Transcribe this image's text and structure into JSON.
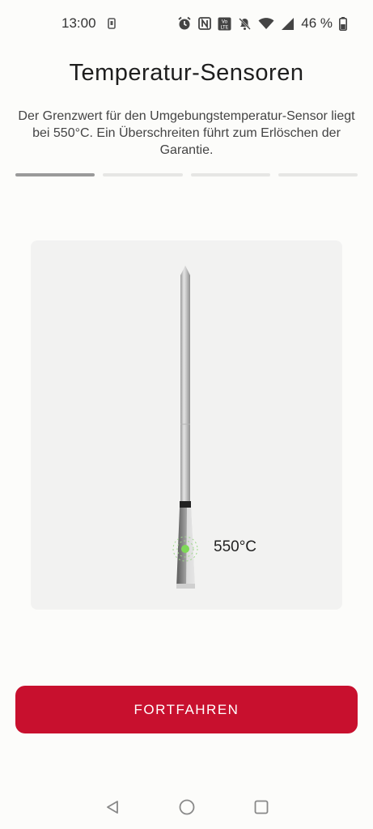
{
  "status_bar": {
    "time": "13:00",
    "battery_percent": "46 %",
    "icons": [
      "phone-notification-icon",
      "alarm-icon",
      "nfc-icon",
      "volte-icon",
      "mute-icon",
      "wifi-icon",
      "signal-icon",
      "battery-icon"
    ]
  },
  "page": {
    "title": "Temperatur-Sensoren",
    "description": "Der Grenzwert für den Umgebungstemperatur-Sensor liegt bei 550°C. Ein Überschreiten führt zum Erlöschen der Garantie."
  },
  "progress": {
    "total_steps": 4,
    "current_step": 1
  },
  "illustration": {
    "sensor_label": "550°C",
    "sensor_indicator_color": "#7ed957"
  },
  "actions": {
    "continue_label": "FORTFAHREN"
  },
  "colors": {
    "accent": "#c8102e",
    "background": "#fcfcfa",
    "card": "#f2f2f1"
  },
  "nav_bar": {
    "icons": [
      "back-icon",
      "home-icon",
      "recents-icon"
    ]
  }
}
